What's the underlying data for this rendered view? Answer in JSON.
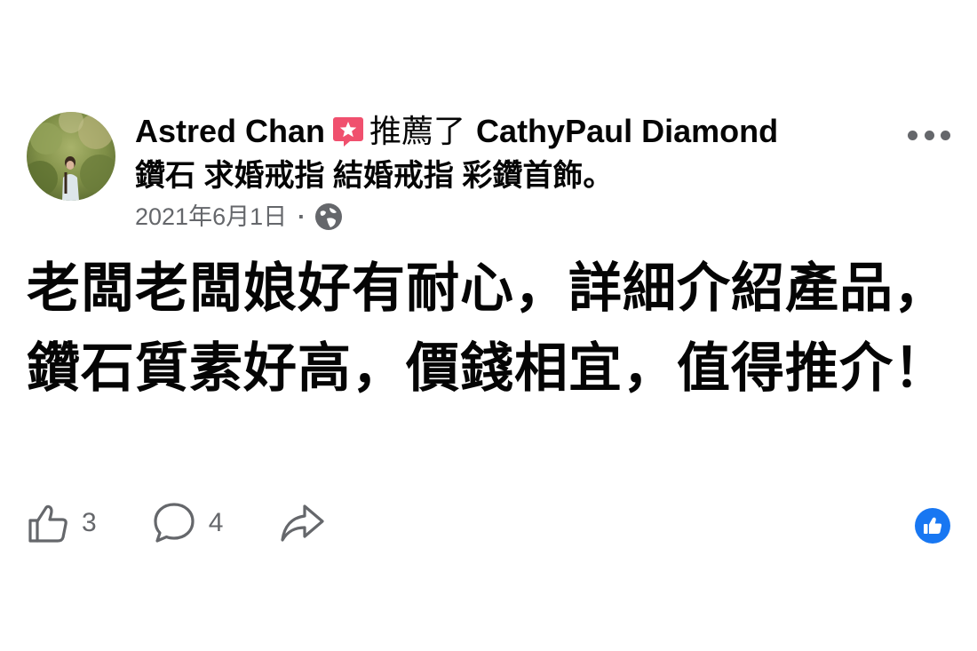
{
  "post": {
    "author": "Astred Chan",
    "recommend_label": "推薦了",
    "page_name": "CathyPaul Diamond",
    "categories": "鑽石 求婚戒指 結婚戒指 彩鑽首飾。",
    "date": "2021年6月1日",
    "separator": "·",
    "privacy_icon": "globe-icon",
    "more_icon": "more-options-icon",
    "body": "老闆老闆娘好有耐心，詳細介紹產品，鑽石質素好高，價錢相宜，值得推介！"
  },
  "actions": {
    "like_icon": "thumbs-up-icon",
    "like_count": "3",
    "comment_icon": "comment-bubble-icon",
    "comment_count": "4",
    "share_icon": "share-arrow-icon",
    "reaction_badge_icon": "like-reaction-icon"
  },
  "colors": {
    "text_primary": "#050505",
    "text_secondary": "#65676b",
    "recommend_badge": "#f0506e",
    "facebook_blue": "#1877f2"
  }
}
